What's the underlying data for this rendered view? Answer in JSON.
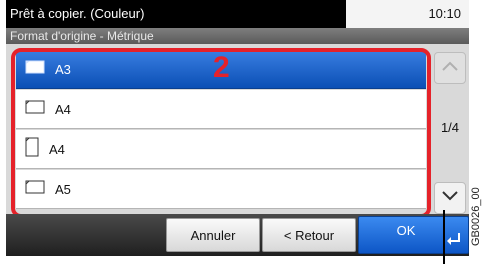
{
  "status": {
    "title": "Prêt à copier. (Couleur)",
    "time": "10:10"
  },
  "screen_title": "Format d'origine - Métrique",
  "list": {
    "items": [
      {
        "label": "A3",
        "icon": "landscape-paper-icon",
        "selected": true
      },
      {
        "label": "A4",
        "icon": "landscape-paper-icon",
        "selected": false
      },
      {
        "label": "A4",
        "icon": "portrait-paper-icon",
        "selected": false
      },
      {
        "label": "A5",
        "icon": "landscape-paper-icon",
        "selected": false
      }
    ]
  },
  "pager": {
    "indicator": "1/4"
  },
  "callout_number": "2",
  "buttons": {
    "cancel": "Annuler",
    "back": "< Retour",
    "ok": "OK"
  },
  "figure_code": "GB0026_00",
  "colors": {
    "accent": "#1560d0",
    "highlight": "#e5222a"
  }
}
